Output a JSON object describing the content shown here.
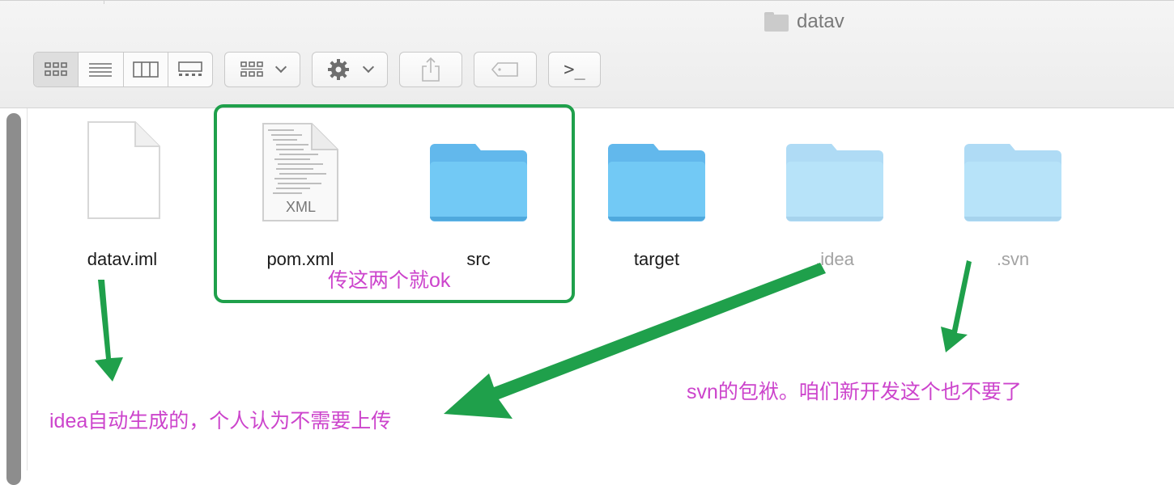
{
  "window": {
    "title": "datav",
    "title_icon": "folder-icon"
  },
  "toolbar": {
    "view_modes": [
      {
        "icon": "icon-view-icon",
        "active": true
      },
      {
        "icon": "list-view-icon",
        "active": false
      },
      {
        "icon": "column-view-icon",
        "active": false
      },
      {
        "icon": "gallery-view-icon",
        "active": false
      }
    ],
    "group_button_icon": "group-icon",
    "action_button_icon": "gear-icon",
    "share_button_icon": "share-icon",
    "tags_button_icon": "tag-icon",
    "terminal_button_label": ">_"
  },
  "files": [
    {
      "name": "datav.iml",
      "kind": "document"
    },
    {
      "name": "pom.xml",
      "kind": "xml-document",
      "badge": "XML"
    },
    {
      "name": "src",
      "kind": "folder"
    },
    {
      "name": "target",
      "kind": "folder"
    },
    {
      "name": ".idea",
      "kind": "folder",
      "hidden": true
    },
    {
      "name": ".svn",
      "kind": "folder",
      "hidden": true
    }
  ],
  "annotations": {
    "selection_note": "传这两个就ok",
    "idea_note": "idea自动生成的，个人认为不需要上传",
    "svn_note": "svn的包袱。咱们新开发这个也不要了",
    "text_color": "#cc44cc",
    "accent_color": "#1fa04b"
  }
}
